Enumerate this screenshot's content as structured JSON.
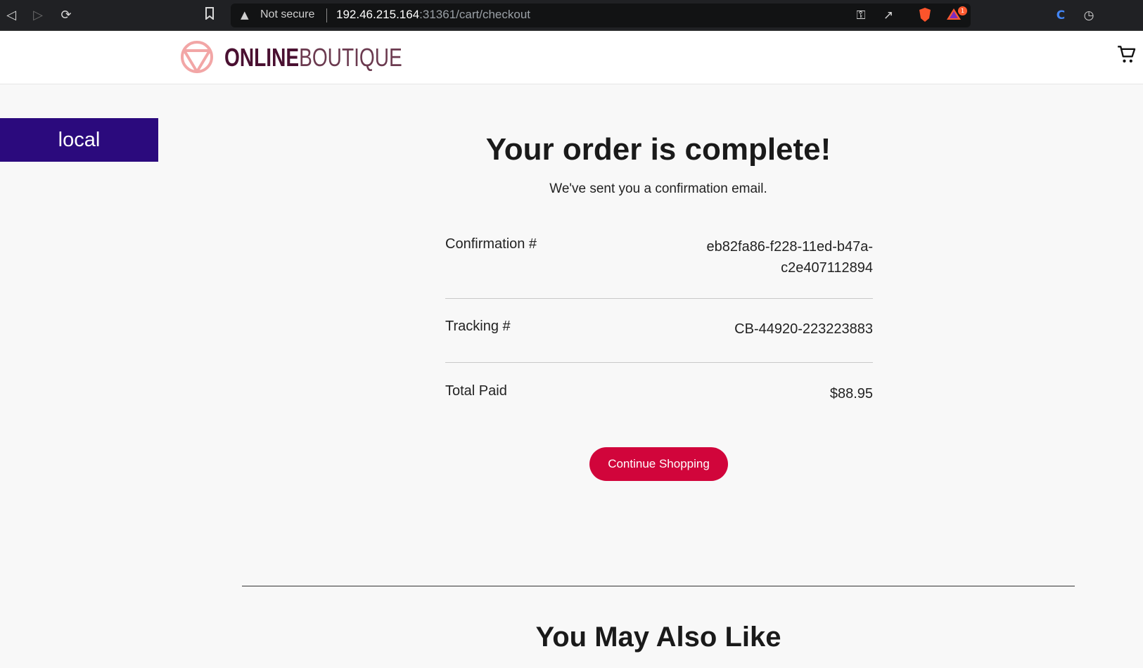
{
  "browser": {
    "security_label": "Not secure",
    "url_host": "192.46.215.164",
    "url_rest": ":31361/cart/checkout",
    "rewards_badge": "1"
  },
  "site": {
    "logo_online": "ONLINE",
    "logo_boutique": "BOUTIQUE",
    "env_tag": "local"
  },
  "order": {
    "title": "Your order is complete!",
    "subtitle": "We've sent you a confirmation email.",
    "confirmation_label": "Confirmation #",
    "confirmation_value_line1": "eb82fa86-f228-11ed-b47a-",
    "confirmation_value_line2": "c2e407112894",
    "tracking_label": "Tracking #",
    "tracking_value": "CB-44920-223223883",
    "total_label": "Total Paid",
    "total_value": "$88.95",
    "continue_label": "Continue Shopping"
  },
  "recommendations": {
    "title": "You May Also Like"
  },
  "colors": {
    "accent": "#d1053b",
    "env_tag_bg": "#2b0a7d",
    "logo_dark": "#4a1031",
    "logo_mark": "#f2a6a6"
  }
}
